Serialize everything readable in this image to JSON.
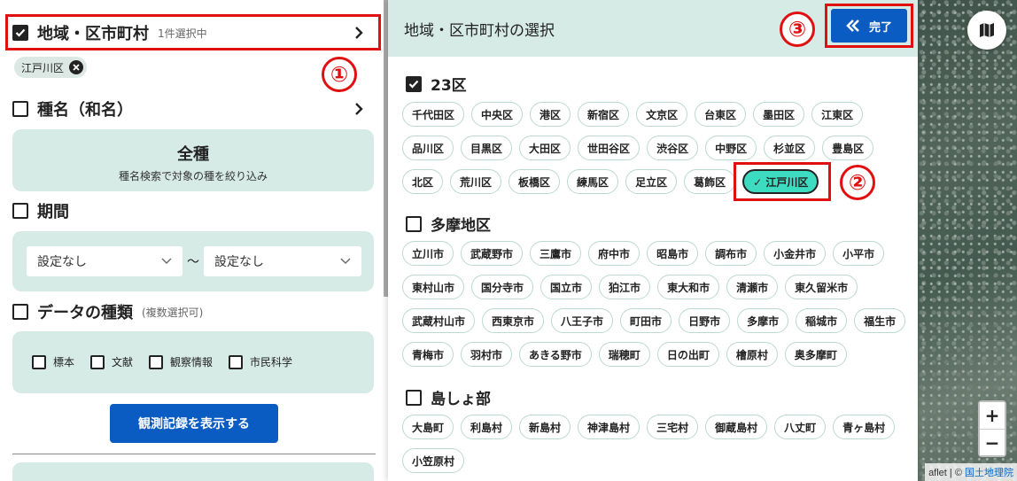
{
  "left": {
    "region": {
      "title": "地域・区市町村",
      "sub": "1件選択中",
      "selected_chip": "江戸川区"
    },
    "species": {
      "title": "種名（和名）",
      "all_title": "全種",
      "all_sub": "種名検索で対象の種を絞り込み"
    },
    "period": {
      "title": "期間",
      "from": "設定なし",
      "to": "設定なし",
      "tilde": "〜"
    },
    "datatype": {
      "title": "データの種類",
      "sub": "(複数選択可)",
      "options": [
        "標本",
        "文献",
        "観察情報",
        "市民科学"
      ]
    },
    "show_button": "観測記録を表示する"
  },
  "annotations": {
    "a1": "①",
    "a2": "②",
    "a3": "③"
  },
  "drawer": {
    "title": "地域・区市町村の選択",
    "done": "完了",
    "groups": [
      {
        "title": "23区",
        "checked": true,
        "items": [
          "千代田区",
          "中央区",
          "港区",
          "新宿区",
          "文京区",
          "台東区",
          "墨田区",
          "江東区",
          "品川区",
          "目黒区",
          "大田区",
          "世田谷区",
          "渋谷区",
          "中野区",
          "杉並区",
          "豊島区",
          "北区",
          "荒川区",
          "板橋区",
          "練馬区",
          "足立区",
          "葛飾区",
          "✓ 江戸川区"
        ]
      },
      {
        "title": "多摩地区",
        "checked": false,
        "items": [
          "立川市",
          "武蔵野市",
          "三鷹市",
          "府中市",
          "昭島市",
          "調布市",
          "小金井市",
          "小平市",
          "東村山市",
          "国分寺市",
          "国立市",
          "狛江市",
          "東大和市",
          "清瀬市",
          "東久留米市",
          "武蔵村山市",
          "西東京市",
          "八王子市",
          "町田市",
          "日野市",
          "多摩市",
          "稲城市",
          "福生市",
          "青梅市",
          "羽村市",
          "あきる野市",
          "瑞穂町",
          "日の出町",
          "檜原村",
          "奥多摩町"
        ]
      },
      {
        "title": "島しょ部",
        "checked": false,
        "items": [
          "大島町",
          "利島村",
          "新島村",
          "神津島村",
          "三宅村",
          "御蔵島村",
          "八丈町",
          "青ヶ島村",
          "小笠原村"
        ]
      }
    ]
  },
  "map": {
    "zoom_in": "+",
    "zoom_out": "−",
    "attribution_prefix": "aflet | © ",
    "attribution_link": "国土地理院"
  }
}
